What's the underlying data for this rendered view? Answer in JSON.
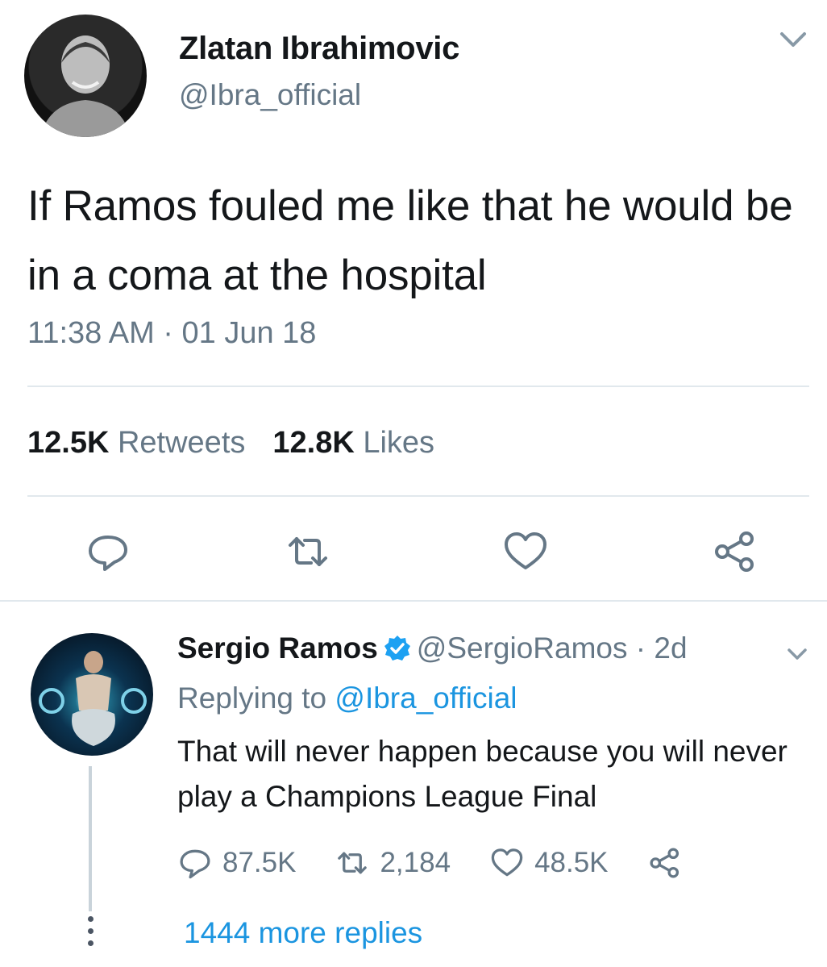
{
  "main_tweet": {
    "author_name": "Zlatan Ibrahimovic",
    "author_handle": "@Ibra_official",
    "text": "If Ramos fouled me like that he would be in a coma at the hospital",
    "timestamp": "11:38 AM · 01 Jun 18",
    "retweets_count": "12.5K",
    "retweets_label": "Retweets",
    "likes_count": "12.8K",
    "likes_label": "Likes",
    "icons": [
      "reply-icon",
      "retweet-icon",
      "like-icon",
      "share-icon",
      "chevron-down-icon"
    ]
  },
  "reply_tweet": {
    "author_name": "Sergio Ramos",
    "author_handle": "@SergioRamos",
    "age": "· 2d",
    "replying_prefix": "Replying to",
    "replying_mention": "@Ibra_official",
    "text": "That will never happen because you will never play a Champions League Final",
    "reply_count": "87.5K",
    "retweet_count": "2,184",
    "like_count": "48.5K",
    "more_replies": "1444 more replies",
    "colors": {
      "link": "#1b95e0",
      "verified": "#1da1f2"
    }
  }
}
